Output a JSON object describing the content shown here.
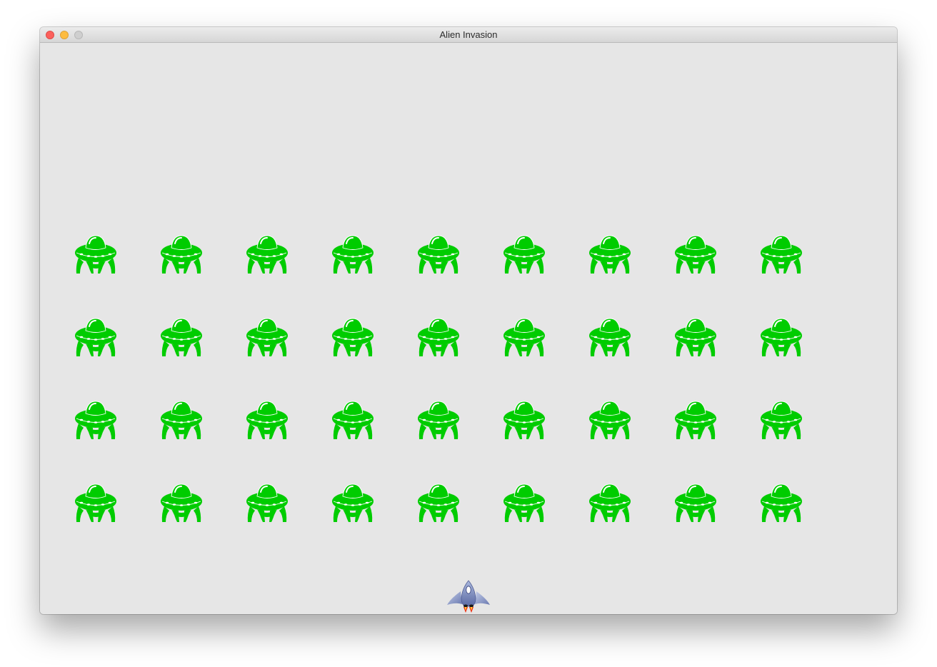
{
  "window": {
    "title": "Alien Invasion"
  },
  "game": {
    "background_color": "#e6e6e6",
    "alien_fleet": {
      "rows": 4,
      "columns": 9,
      "alien_count": 36,
      "alien_icon": "ufo-alien-icon",
      "alien_color": "#00cc00"
    },
    "player_ship": {
      "icon": "rocket-ship-icon"
    }
  }
}
